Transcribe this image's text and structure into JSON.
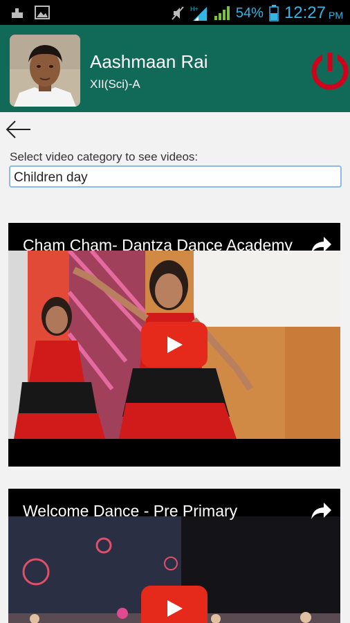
{
  "status_bar": {
    "battery": "54%",
    "time": "12:27",
    "period": "PM",
    "icons": [
      "usb-icon",
      "image-icon",
      "mute-icon",
      "data-signal-icon",
      "signal-icon",
      "battery-icon"
    ]
  },
  "header": {
    "user_name": "Aashmaan Rai",
    "user_class": "XII(Sci)-A",
    "background_color": "#116a58",
    "power_color": "#d0021b"
  },
  "filter": {
    "label": "Select video category to see videos:",
    "selected": "Children day"
  },
  "videos": [
    {
      "title": "Cham Cham- Dantza Dance Academy"
    },
    {
      "title": "Welcome Dance - Pre Primary"
    }
  ]
}
